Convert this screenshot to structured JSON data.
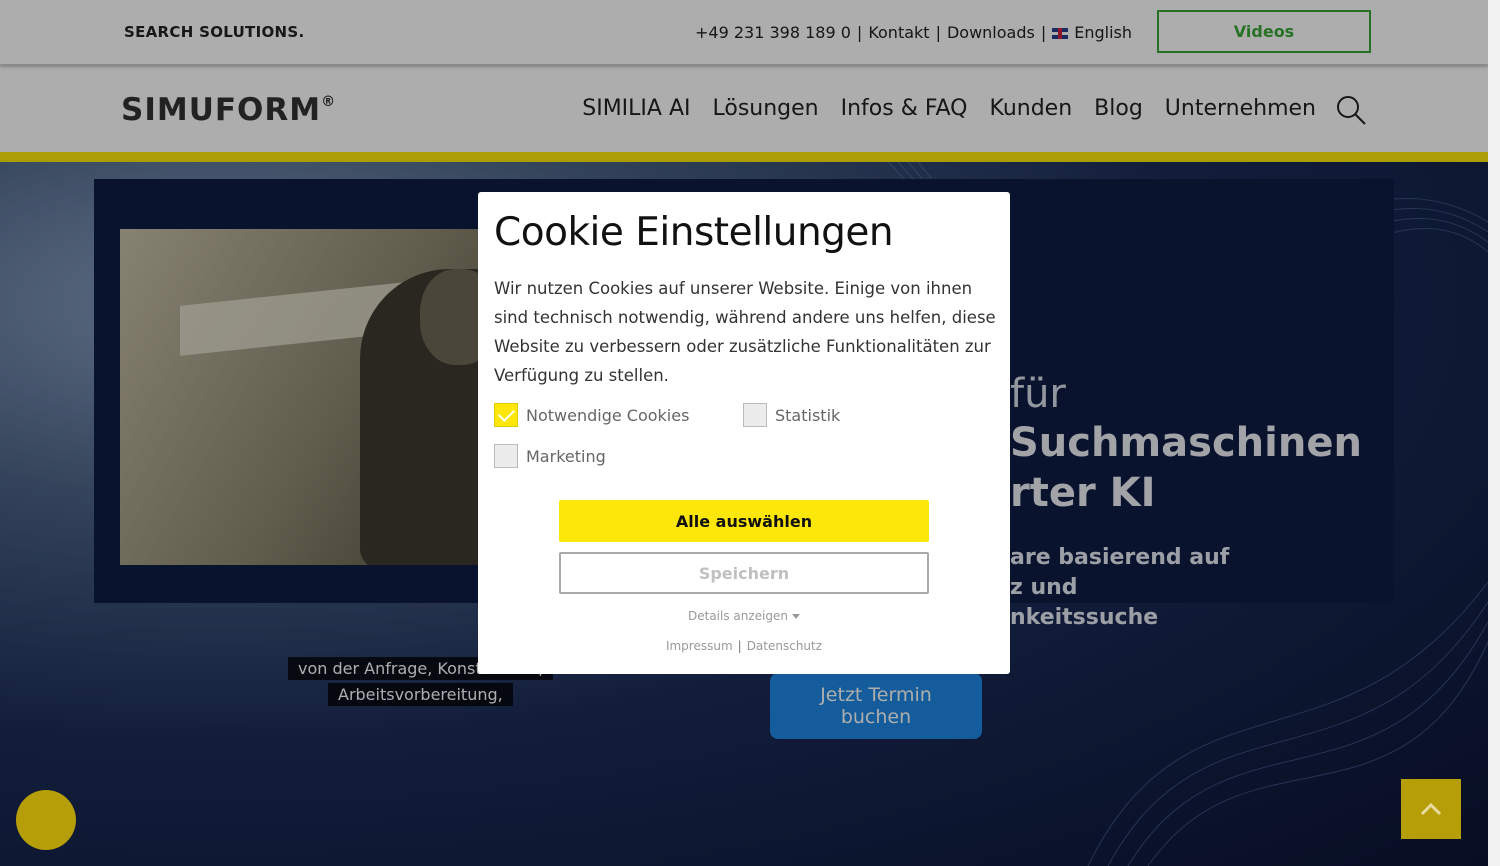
{
  "topbar": {
    "tagline": "SEARCH SOLUTIONS.",
    "phone": "+49 231 398 189 0",
    "separator": "|",
    "kontakt": "Kontakt",
    "downloads": "Downloads",
    "language": "English",
    "videos_label": "Videos"
  },
  "navbar": {
    "logo": "SIMUFORM",
    "logo_mark": "®",
    "items": [
      "SIMILIA AI",
      "Lösungen",
      "Infos & FAQ",
      "Kunden",
      "Blog",
      "Unternehmen"
    ]
  },
  "hero": {
    "subtitle_line1": "von der Anfrage, Konstruktion,",
    "subtitle_line2": "Arbeitsvorbereitung,",
    "headline_small": "für",
    "headline_line1": "Suchmaschinen",
    "headline_line2": "rter KI",
    "sub_line1": "are basierend auf",
    "sub_line2": "z und",
    "sub_line3": "nkeitssuche",
    "cta_line1": "Jetzt Termin",
    "cta_line2": "buchen"
  },
  "cookie": {
    "title": "Cookie Einstellungen",
    "description": "Wir nutzen Cookies auf unserer Website. Einige von ihnen sind technisch notwendig, während andere uns helfen, diese Website zu verbessern oder zusätzliche Funktionalitäten zur Verfügung zu stellen.",
    "options": {
      "necessary": "Notwendige Cookies",
      "statistics": "Statistik",
      "marketing": "Marketing"
    },
    "select_all": "Alle auswählen",
    "save": "Speichern",
    "details": "Details anzeigen",
    "impressum": "Impressum",
    "datenschutz": "Datenschutz",
    "legal_sep": "|"
  },
  "colors": {
    "accent_yellow": "#fde70a",
    "videos_green": "#3aa935",
    "cta_blue": "#1e88e5"
  }
}
